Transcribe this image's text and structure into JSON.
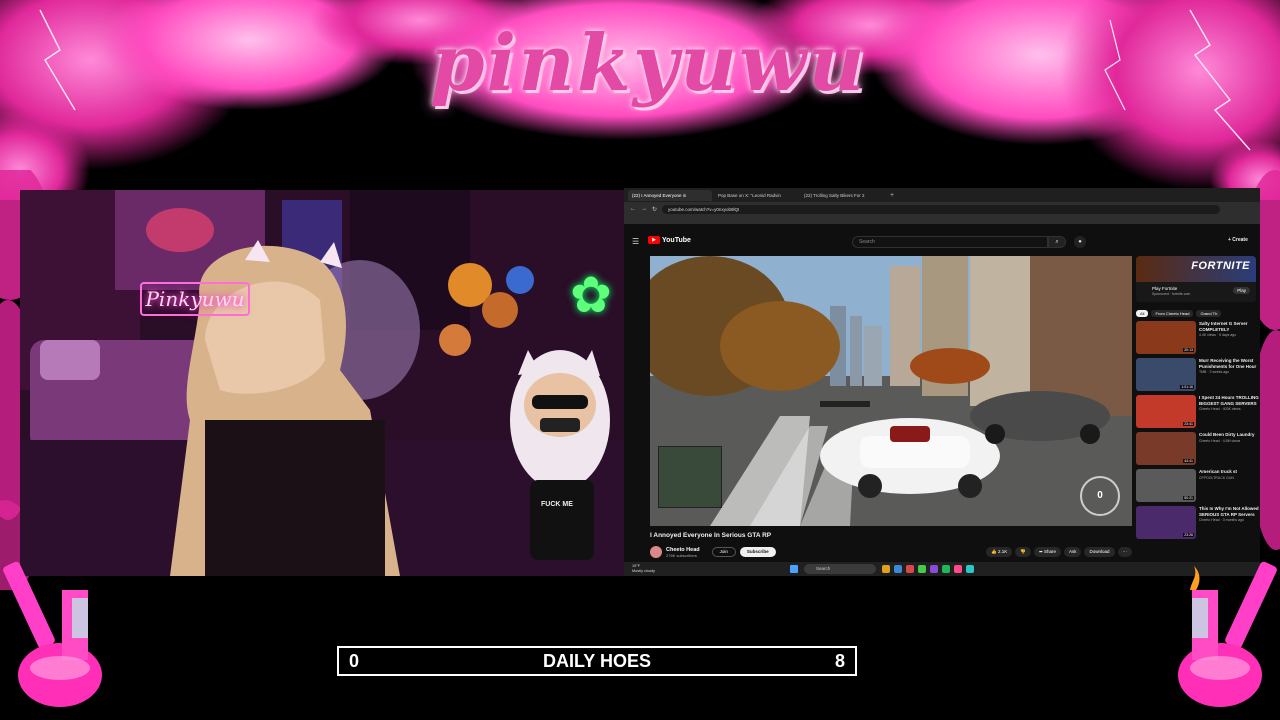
{
  "overlay": {
    "logo_text": "pinkyuwu",
    "neon_sign_text": "Pinkyuwu",
    "avatar_shirt_text": "FUCK ME"
  },
  "browser": {
    "tabs": [
      {
        "label": "(22) I Annoyed Everyone in",
        "active": true
      },
      {
        "label": "Pop Base on X: \"Leonid Radvin",
        "active": false
      },
      {
        "label": "(22) Trolling Salty Bikers For 2",
        "active": false
      }
    ],
    "new_tab_symbol": "+",
    "url": "youtube.com/watch?v=y0nxyob9lQI"
  },
  "youtube": {
    "brand": "YouTube",
    "search_placeholder": "Search",
    "create_label": "+ Create",
    "video_title": "I Annoyed Everyone In Serious GTA RP",
    "channel_name": "Cheeto Head",
    "channel_subs": "276K subscribers",
    "join_label": "Join",
    "subscribe_label": "Subscribe",
    "actions": [
      "👍 2.1K",
      "👎",
      "➦ Share",
      "Ask",
      "Download",
      "⋯"
    ],
    "speedometer": "0",
    "ad": {
      "brand": "FORTNITE",
      "title": "Play Fortnite",
      "sub": "Sponsored · fortnite.com",
      "play": "Play"
    },
    "chips": [
      {
        "label": "All",
        "on": true
      },
      {
        "label": "From Cheeto Head",
        "on": false
      },
      {
        "label": "Grand Th",
        "on": false
      }
    ],
    "recommendations": [
      {
        "title": "Salty Internet G Server COMPLETELY",
        "meta": "4.4K views · 5 days ago",
        "duration": "20:13",
        "color": "#8a3a1a"
      },
      {
        "title": "Murr Receiving the Worst Punishments for One Hour",
        "meta": "TMB · 2 weeks ago",
        "duration": "1:01:16",
        "color": "#3a4a6a"
      },
      {
        "title": "I Spent 24 Hours TROLLING BIGGEST GANG SERVERS",
        "meta": "Cheeto Head · 403K views",
        "duration": "23:41",
        "color": "#c43a2a"
      },
      {
        "title": "Could Been Dirty Laundry",
        "meta": "Cheeto Head · 4.5M views",
        "duration": "44:41",
        "color": "#7a3a2a"
      },
      {
        "title": "American truck st",
        "meta": "CFPOOLTRUCK GUN",
        "duration": "50:21",
        "color": "#5a5a5a"
      },
      {
        "title": "This Is Why I'm Not Allowed SERIOUS GTA RP Servers",
        "meta": "Cheeto Head · 3 months ago",
        "duration": "23:26",
        "color": "#4a2a6a"
      }
    ]
  },
  "taskbar": {
    "weather_temp": "19°F",
    "weather_desc": "Mostly cloudy",
    "search_label": "Search"
  },
  "counter": {
    "left_value": "0",
    "label": "DAILY HOES",
    "right_value": "8"
  },
  "colors": {
    "accent_pink": "#e24aa6",
    "youtube_red": "#ff0000",
    "counter_border": "#ffffff"
  }
}
